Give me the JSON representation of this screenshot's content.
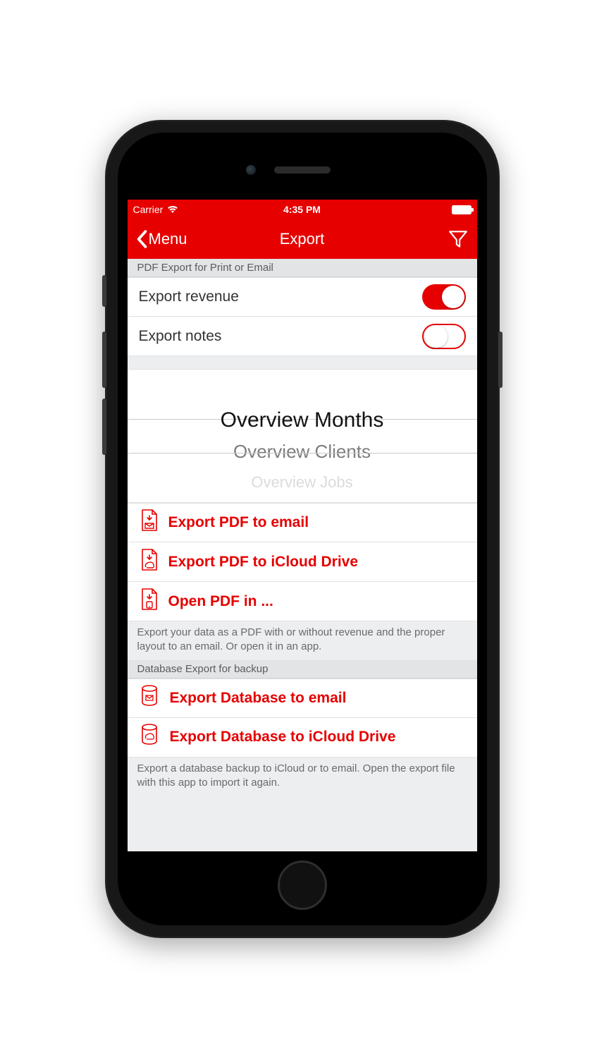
{
  "status": {
    "carrier": "Carrier",
    "time": "4:35 PM"
  },
  "nav": {
    "back_label": "Menu",
    "title": "Export"
  },
  "section1": {
    "header": "PDF Export for Print or Email",
    "toggle1_label": "Export revenue",
    "toggle1_on": true,
    "toggle2_label": "Export notes",
    "toggle2_on": false
  },
  "picker": {
    "options": [
      "Overview Months",
      "Overview Clients",
      "Overview Jobs"
    ],
    "selected_index": 0
  },
  "pdf_actions": {
    "email": "Export PDF to email",
    "icloud": "Export PDF to iCloud Drive",
    "open": "Open PDF in ..."
  },
  "pdf_footer": "Export your data as a PDF with or without revenue and the proper layout to an email. Or open it in an app.",
  "db_section": {
    "header": "Database Export for backup",
    "email": "Export Database to email",
    "icloud": "Export Database to iCloud Drive",
    "footer": "Export a database backup to iCloud or to email. Open the export file with this app to import it again."
  }
}
